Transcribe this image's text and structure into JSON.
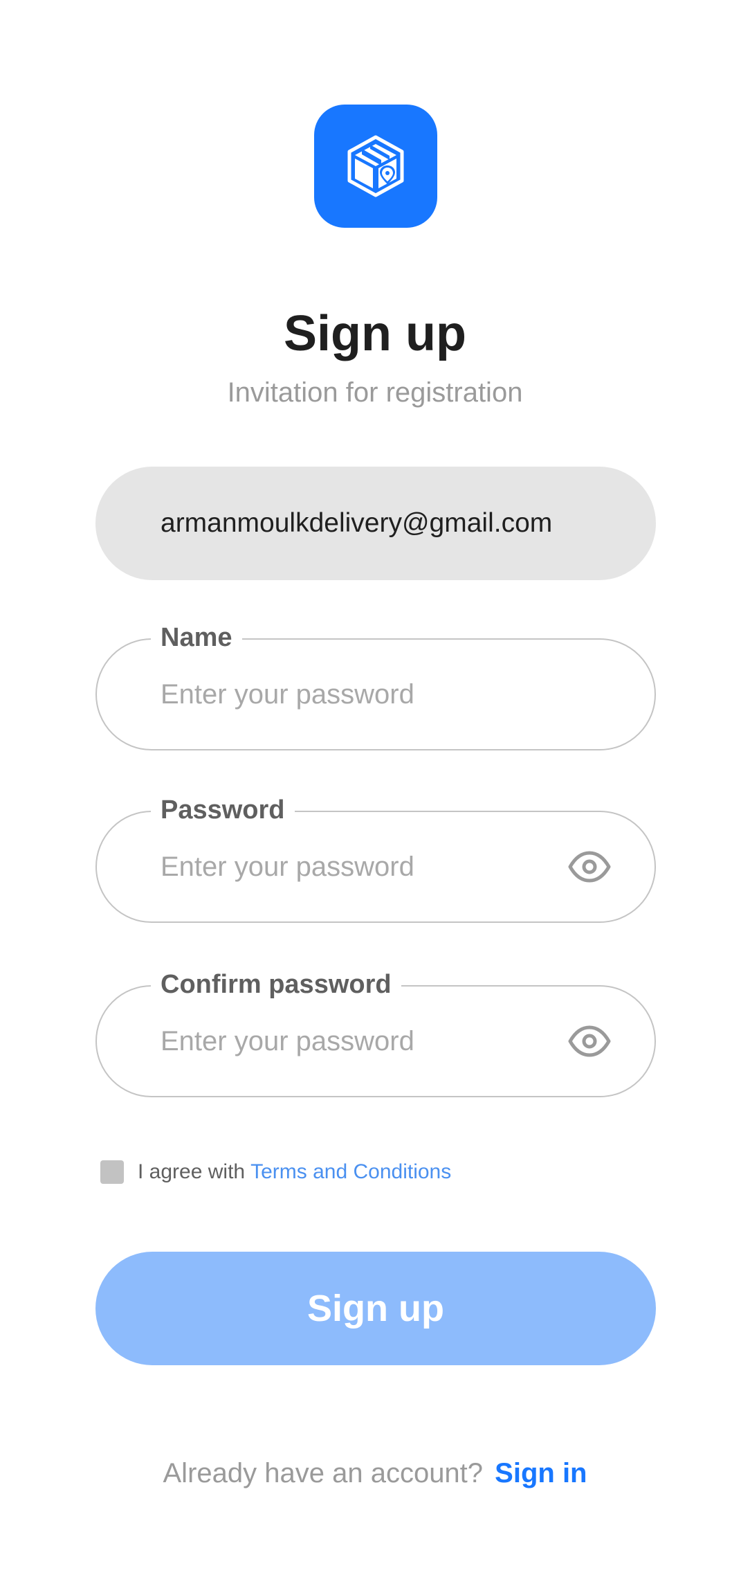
{
  "colors": {
    "accent": "#1877ff",
    "button_disabled": "#8dbbfc",
    "link": "#4a90f0",
    "field_fill": "#e5e5e5",
    "field_border": "#c4c4c4"
  },
  "logo": {
    "icon": "delivery-box-location-icon"
  },
  "header": {
    "title": "Sign up",
    "subtitle": "Invitation for registration"
  },
  "email": {
    "value": "armanmoulkdelivery@gmail.com"
  },
  "fields": {
    "name": {
      "label": "Name",
      "placeholder": "Enter your password",
      "value": ""
    },
    "password": {
      "label": "Password",
      "placeholder": "Enter your password",
      "value": "",
      "toggle_icon": "eye-icon"
    },
    "confirm_password": {
      "label": "Confirm password",
      "placeholder": "Enter your password",
      "value": "",
      "toggle_icon": "eye-icon"
    }
  },
  "agreement": {
    "checked": false,
    "text": "I agree with",
    "link_text": "Terms and Conditions"
  },
  "submit": {
    "label": "Sign up",
    "enabled": false
  },
  "footer": {
    "text": "Already have an account?",
    "link_text": "Sign in"
  }
}
